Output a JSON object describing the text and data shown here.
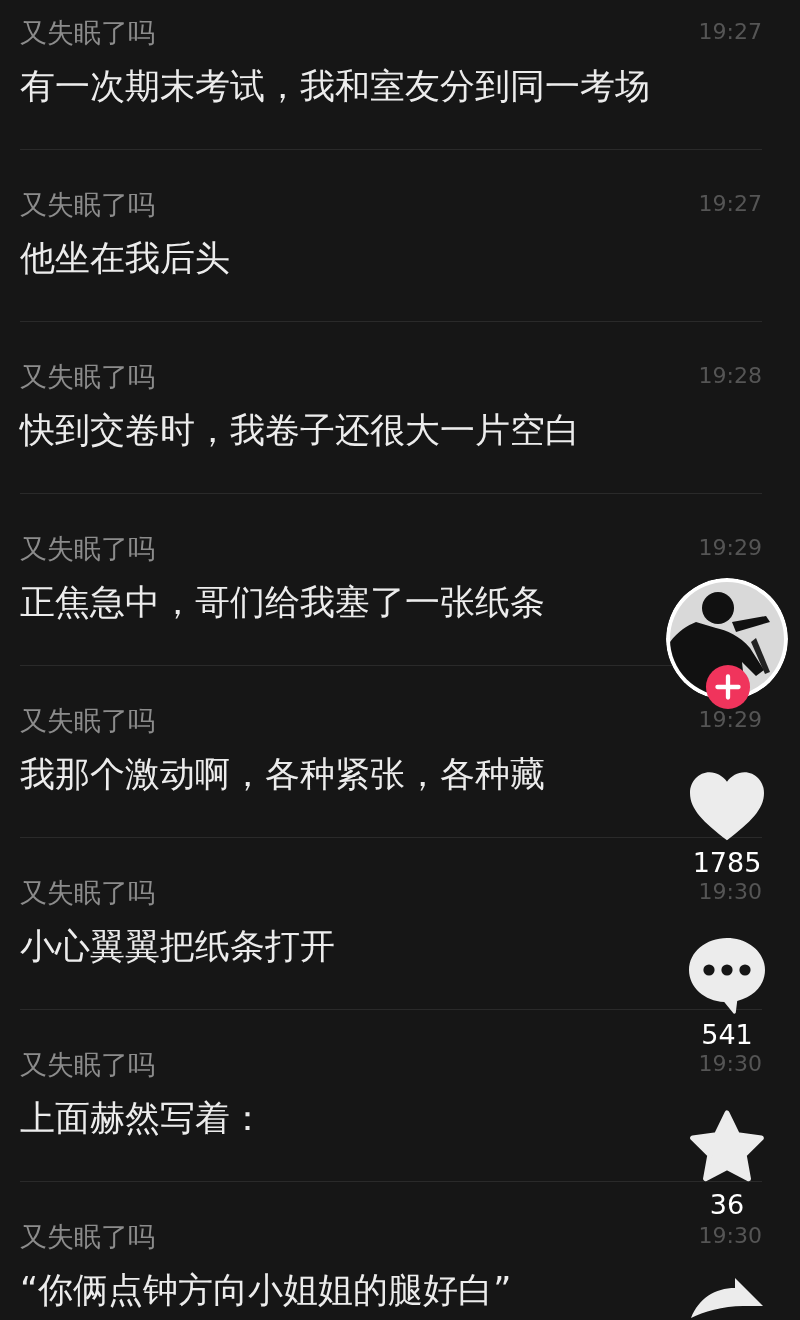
{
  "messages": [
    {
      "name": "又失眠了吗",
      "time": "19:27",
      "text": "有一次期末考试，我和室友分到同一考场"
    },
    {
      "name": "又失眠了吗",
      "time": "19:27",
      "text": "他坐在我后头"
    },
    {
      "name": "又失眠了吗",
      "time": "19:28",
      "text": "快到交卷时，我卷子还很大一片空白"
    },
    {
      "name": "又失眠了吗",
      "time": "19:29",
      "text": "正焦急中，哥们给我塞了一张纸条"
    },
    {
      "name": "又失眠了吗",
      "time": "19:29",
      "text": "我那个激动啊，各种紧张，各种藏"
    },
    {
      "name": "又失眠了吗",
      "time": "19:30",
      "text": "小心翼翼把纸条打开"
    },
    {
      "name": "又失眠了吗",
      "time": "19:30",
      "text": "上面赫然写着："
    },
    {
      "name": "又失眠了吗",
      "time": "19:30",
      "text": "“你俩点钟方向小姐姐的腿好白”"
    }
  ],
  "side_bar": {
    "avatar": {
      "kind": "picture",
      "follow_badge": true
    },
    "actions": [
      {
        "kind": "like",
        "count": "1785"
      },
      {
        "kind": "comment",
        "count": "541"
      },
      {
        "kind": "favorite",
        "count": "36"
      },
      {
        "kind": "share"
      }
    ]
  }
}
